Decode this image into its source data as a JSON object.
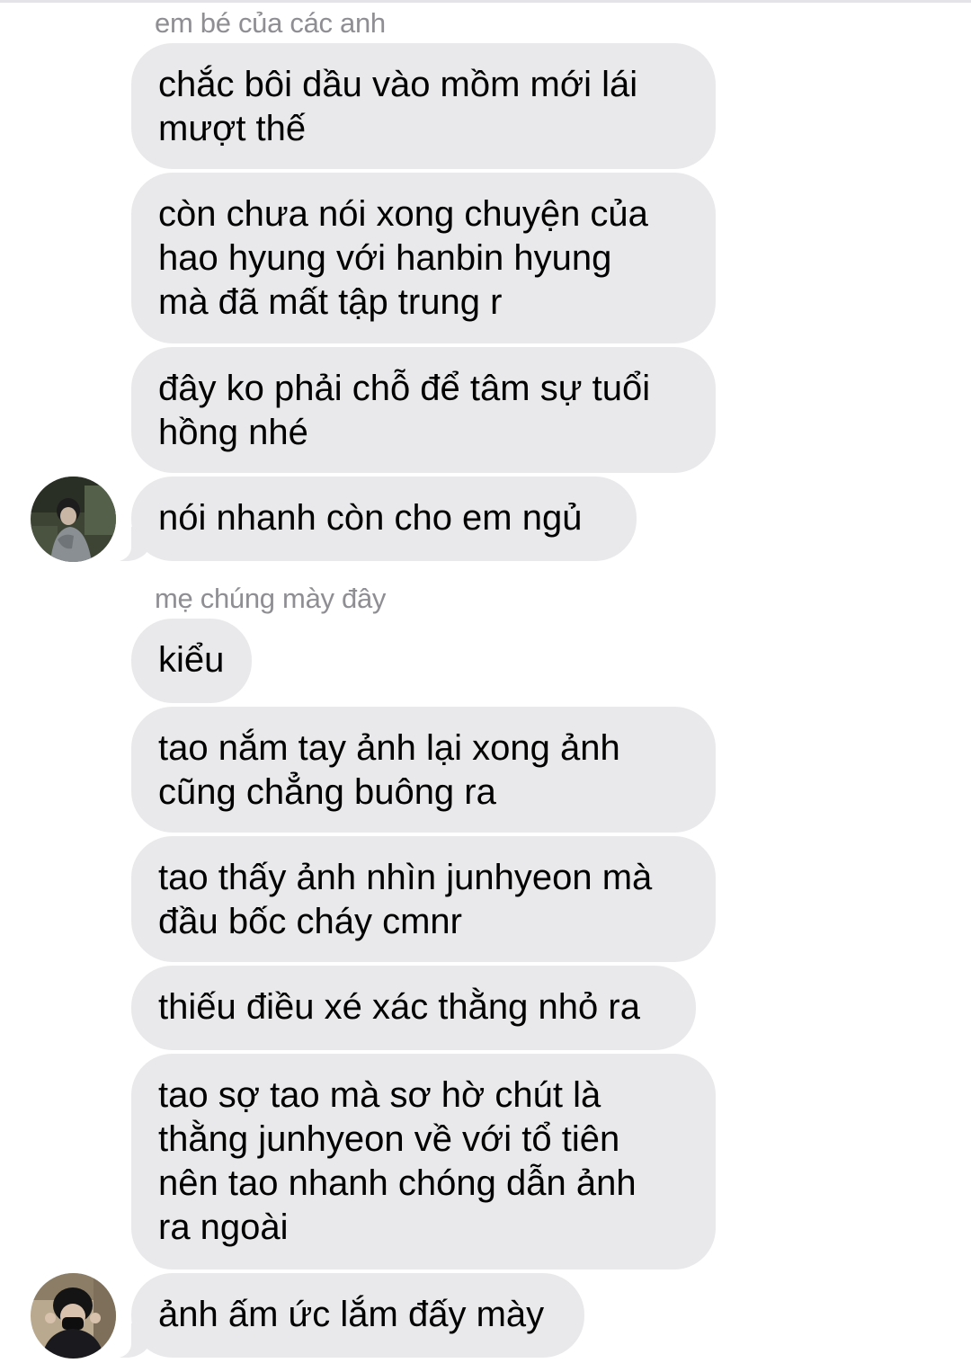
{
  "groups": [
    {
      "sender": "em bé của các anh",
      "messages": [
        "chắc bôi dầu vào mồm mới lái\nmượt thế",
        "còn chưa nói xong chuyện của\nhao hyung với hanbin hyung\nmà đã mất tập trung r",
        "đây ko phải chỗ để tâm sự tuổi\nhồng nhé",
        "nói nhanh còn cho em ngủ"
      ]
    },
    {
      "sender": "mẹ chúng mày đây",
      "messages": [
        "kiểu",
        "tao nắm tay ảnh lại xong ảnh\ncũng chẳng buông ra",
        "tao thấy ảnh nhìn junhyeon mà\nđầu bốc cháy cmnr",
        "thiếu điều xé xác thằng nhỏ ra",
        "tao sợ tao mà sơ hờ chút là\nthằng junhyeon về với tổ tiên\nnên tao nhanh chóng dẫn ảnh\nra ngoài",
        "ảnh ấm ức lắm đấy mày"
      ]
    }
  ],
  "colors": {
    "bubble": "#e9e9eb",
    "sender_name": "#8e8e93",
    "text": "#000000"
  },
  "icons": {
    "avatar_1": "user-photo-avatar",
    "avatar_2": "user-photo-avatar-masked"
  }
}
